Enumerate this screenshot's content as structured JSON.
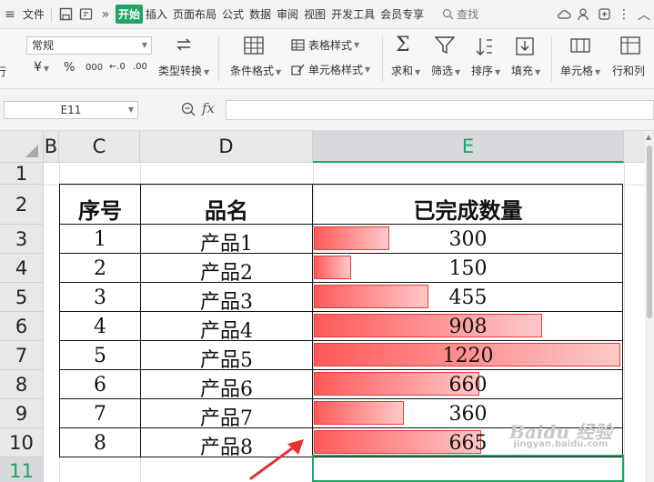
{
  "menubar": {
    "file_label": "文件",
    "tabs": [
      "开始",
      "插入",
      "页面布局",
      "公式",
      "数据",
      "审阅",
      "视图",
      "开发工具",
      "会员专享"
    ],
    "active_tab": "开始",
    "search_label": "查找"
  },
  "ribbon": {
    "number_format": "常规",
    "currency_symbol": "¥",
    "percent_symbol": "%",
    "thousands_symbol": "000",
    "inc_decimal": "←.0",
    "dec_decimal": ".00",
    "type_convert": "类型转换",
    "conditional_format": "条件格式",
    "table_style": "表格样式",
    "cell_style": "单元格样式",
    "sum": "求和",
    "filter": "筛选",
    "sort": "排序",
    "fill": "填充",
    "cell": "单元格",
    "row_col": "行和列",
    "left_cut": "行"
  },
  "formula_bar": {
    "name_box": "E11",
    "fx": "fx",
    "formula": ""
  },
  "sheet": {
    "columns": [
      "B",
      "C",
      "D",
      "E"
    ],
    "selected_column": "E",
    "rows": [
      "1",
      "2",
      "3",
      "4",
      "5",
      "6",
      "7",
      "8",
      "9",
      "10",
      "11"
    ],
    "selected_row": "11",
    "table": {
      "headers": [
        "序号",
        "品名",
        "已完成数量"
      ],
      "rows": [
        {
          "no": "1",
          "name": "产品1",
          "qty": 300
        },
        {
          "no": "2",
          "name": "产品2",
          "qty": 150
        },
        {
          "no": "3",
          "name": "产品3",
          "qty": 455
        },
        {
          "no": "4",
          "name": "产品4",
          "qty": 908
        },
        {
          "no": "5",
          "name": "产品5",
          "qty": 1220
        },
        {
          "no": "6",
          "name": "产品6",
          "qty": 660
        },
        {
          "no": "7",
          "name": "产品7",
          "qty": 360
        },
        {
          "no": "8",
          "name": "产品8",
          "qty": 665
        }
      ],
      "bar_max": 1220
    }
  },
  "watermark": {
    "line1": "Baidu 经验",
    "line2": "jingyan.baidu.com"
  },
  "colors": {
    "accent": "#21a366",
    "bar_start": "#ff5a5a",
    "bar_end": "#ffc9c9",
    "arrow": "#e53333"
  }
}
